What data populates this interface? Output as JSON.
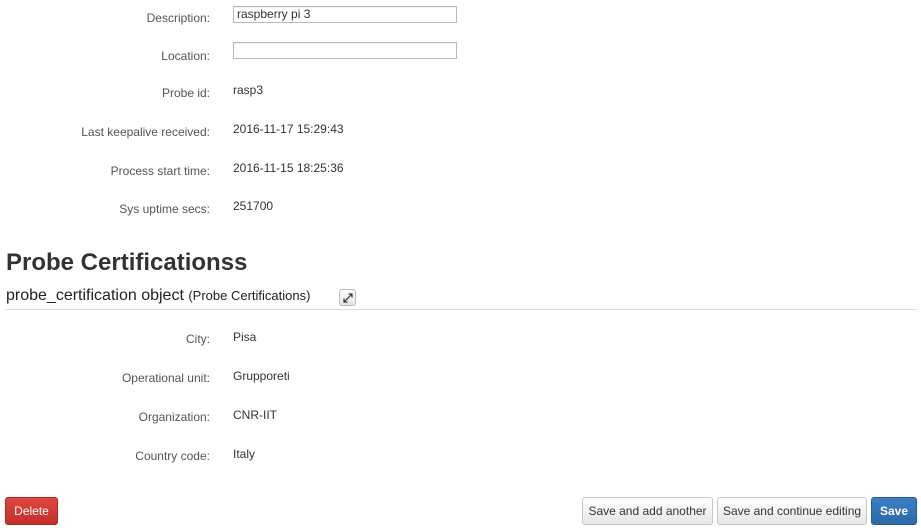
{
  "probe_fields": {
    "description": {
      "label": "Description:",
      "value": "raspberry pi 3"
    },
    "location": {
      "label": "Location:",
      "value": ""
    },
    "probe_id": {
      "label": "Probe id:",
      "value": "rasp3"
    },
    "last_keepalive": {
      "label": "Last keepalive received:",
      "value": "2016-11-17 15:29:43"
    },
    "process_start": {
      "label": "Process start time:",
      "value": "2016-11-15 18:25:36"
    },
    "sys_uptime": {
      "label": "Sys uptime secs:",
      "value": "251700"
    }
  },
  "certifications": {
    "section_title": "Probe Certificationss",
    "object_title": "probe_certification object",
    "object_type": "(Probe Certifications)",
    "expand_icon": "expand-arrows-icon",
    "fields": {
      "city": {
        "label": "City:",
        "value": "Pisa"
      },
      "operational_unit": {
        "label": "Operational unit:",
        "value": "Grupporeti"
      },
      "organization": {
        "label": "Organization:",
        "value": "CNR-IIT"
      },
      "country_code": {
        "label": "Country code:",
        "value": "Italy"
      }
    }
  },
  "actions": {
    "delete": "Delete",
    "save_add_another": "Save and add another",
    "save_continue": "Save and continue editing",
    "save": "Save"
  },
  "colors": {
    "delete": "#d23b35",
    "save": "#3271b5"
  }
}
